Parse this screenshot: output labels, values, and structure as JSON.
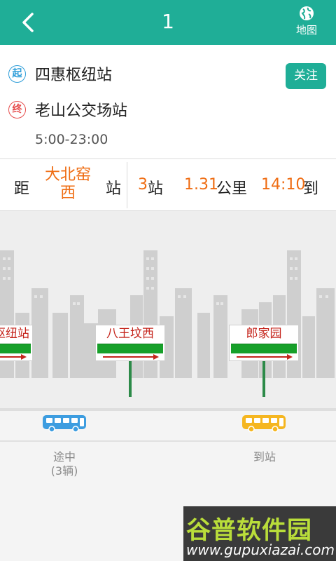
{
  "header": {
    "title": "1",
    "map_label": "地图",
    "bg_color": "#1fae97"
  },
  "route": {
    "start_badge": "起",
    "start_name": "四惠枢纽站",
    "end_badge": "终",
    "end_name": "老山公交场站",
    "hours": "5:00-23:00",
    "follow_label": "关注"
  },
  "distance": {
    "prefix": "距",
    "station": "大北窑西",
    "station_line1": "大北窑",
    "station_line2": "西",
    "suffix": "站",
    "stops_value": "3",
    "stops_unit": "站",
    "km_value": "1.31",
    "km_unit": "公里",
    "time_value": "14:10",
    "time_unit": "到"
  },
  "stops": [
    {
      "name": "枢纽站"
    },
    {
      "name": "八王坟西"
    },
    {
      "name": "郎家园"
    }
  ],
  "buses": [
    {
      "status": "途中",
      "count": "(3辆)",
      "color": "#3d9de0"
    },
    {
      "status": "到站",
      "color": "#f5b620"
    }
  ],
  "watermark": {
    "title": "谷普软件园",
    "url": "www.gupuxiazai.com"
  }
}
